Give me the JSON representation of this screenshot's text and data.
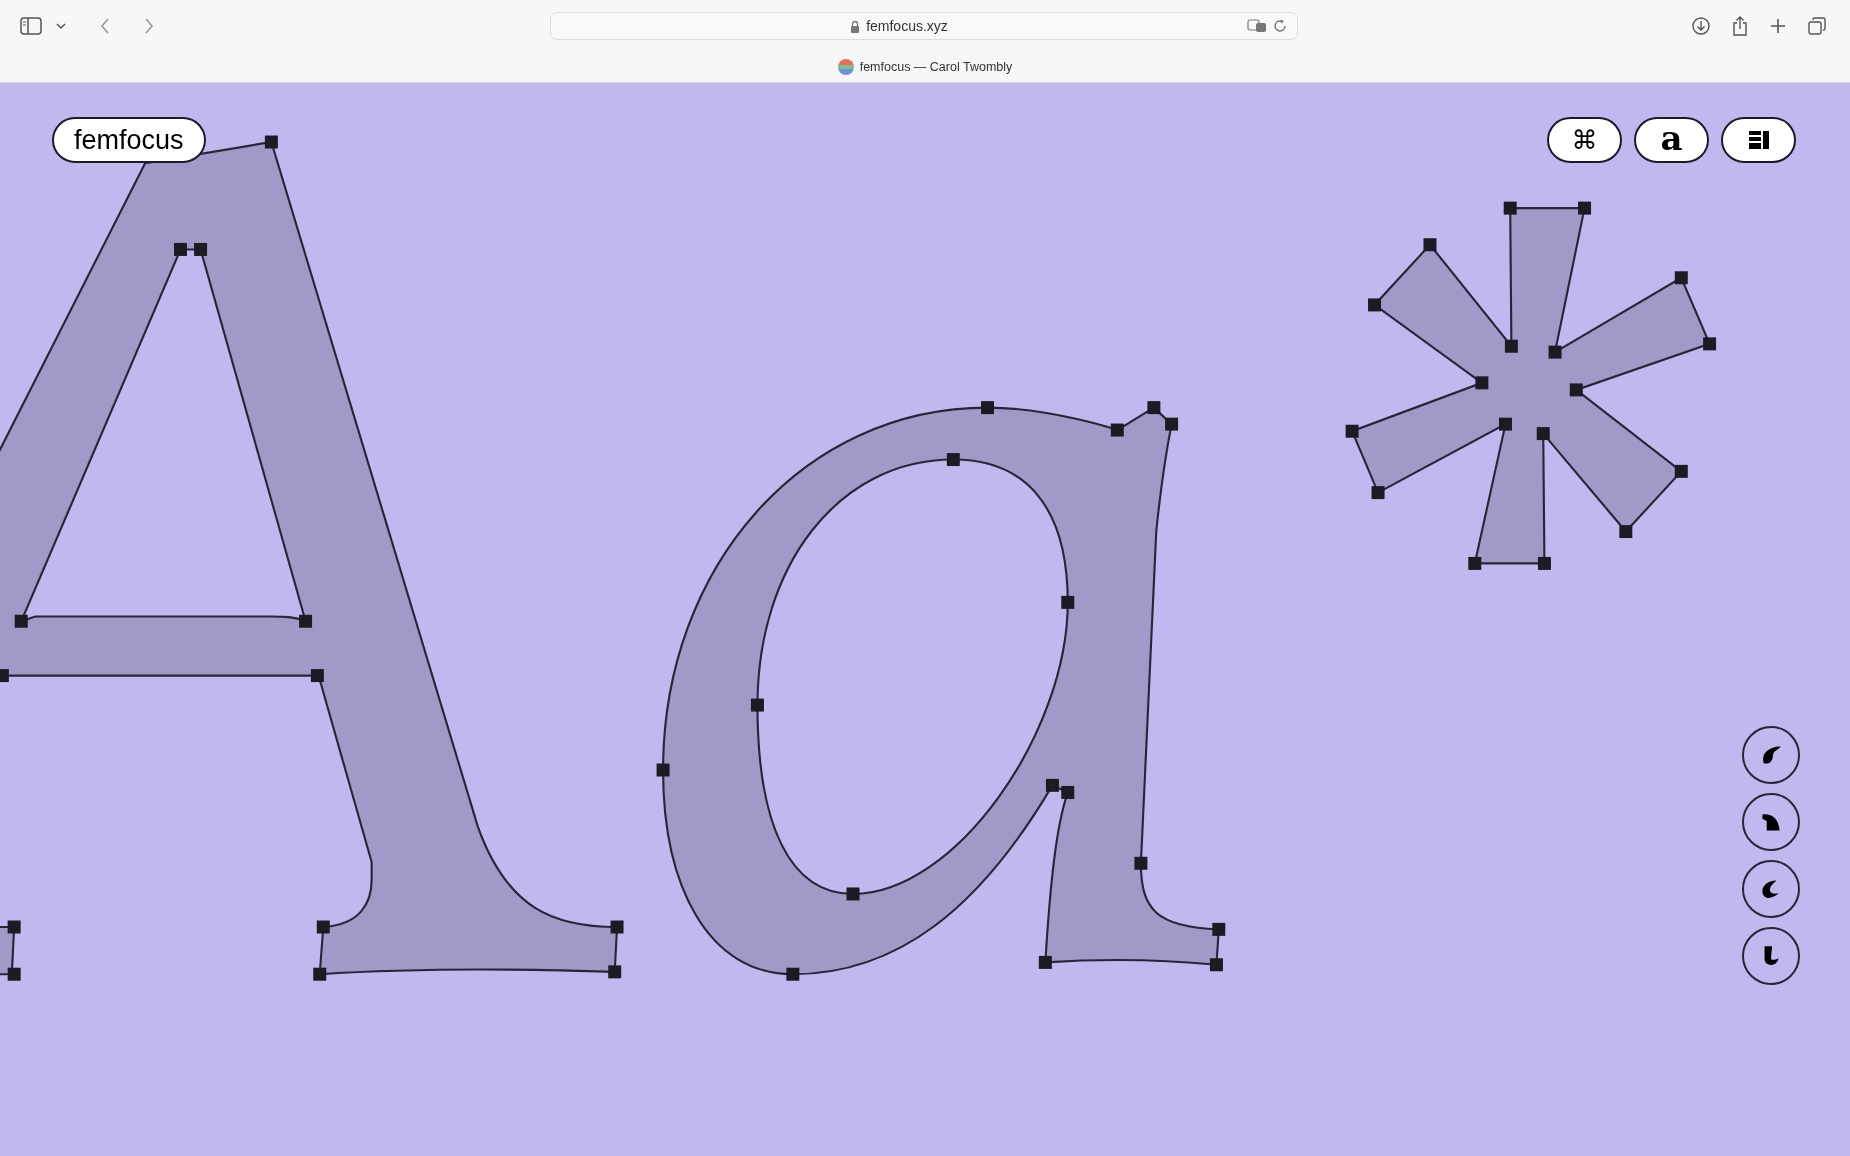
{
  "browser": {
    "address": "femfocus.xyz",
    "tab_title": "femfocus — Carol Twombly"
  },
  "page": {
    "logo": "femfocus",
    "top_buttons": [
      {
        "kind": "text",
        "label": "⌘"
      },
      {
        "kind": "glyph",
        "label": "a"
      },
      {
        "kind": "layout"
      }
    ],
    "side_buttons": [
      {
        "kind": "teardrop"
      },
      {
        "kind": "shoulder"
      },
      {
        "kind": "crescent"
      },
      {
        "kind": "hook"
      }
    ]
  }
}
